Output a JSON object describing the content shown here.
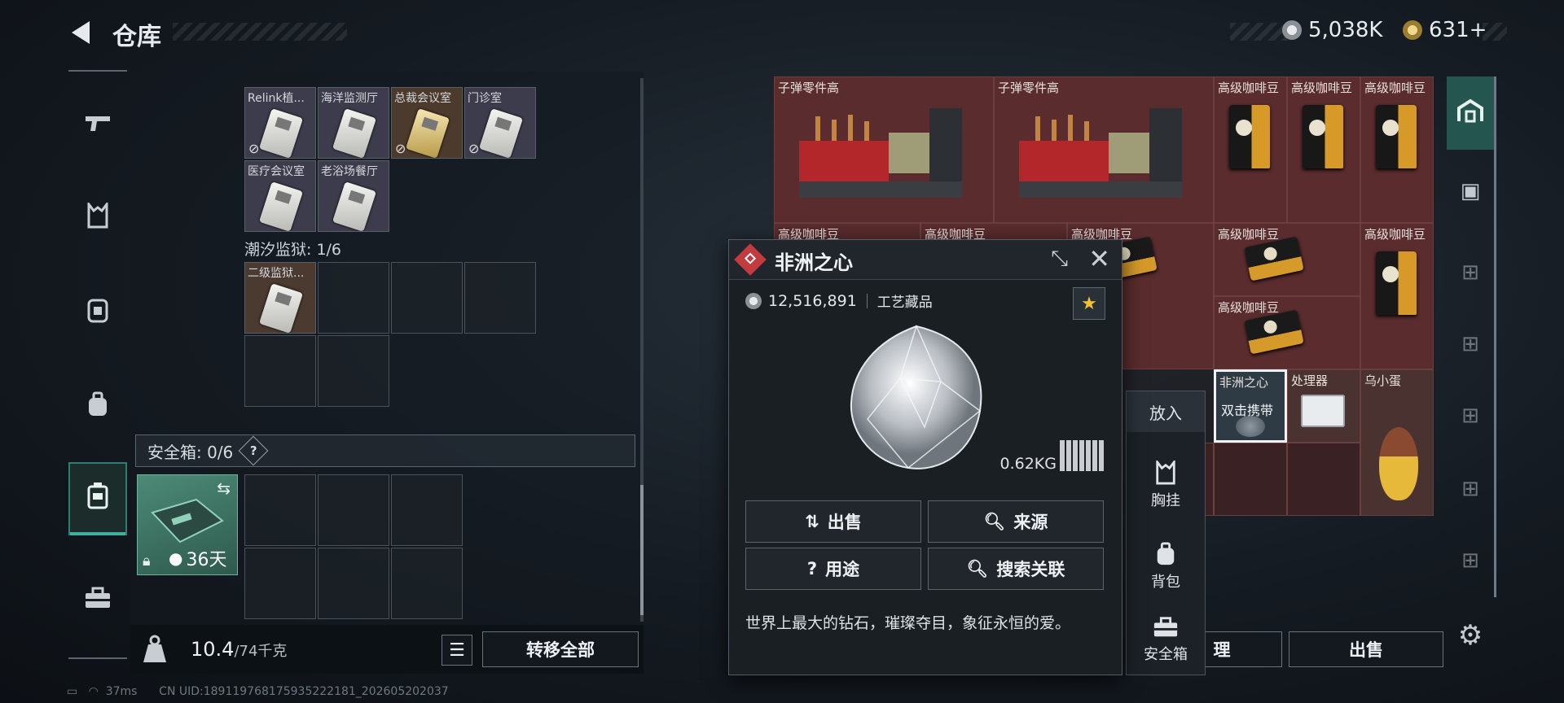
{
  "header": {
    "title": "仓库",
    "currency_1": "5,038K",
    "currency_2": "631+"
  },
  "left_rail": {
    "items": [
      "gun-icon",
      "vest-icon",
      "armor-icon",
      "backpack-icon",
      "safebox-icon",
      "toolbox-icon"
    ],
    "active_index": 4
  },
  "key_items": [
    {
      "label": "Relink植...",
      "banned": true
    },
    {
      "label": "海洋监测厅",
      "banned": false
    },
    {
      "label": "总裁会议室",
      "banned": true
    },
    {
      "label": "门诊室",
      "banned": true
    },
    {
      "label": "医疗会议室",
      "banned": false
    },
    {
      "label": "老浴场餐厅",
      "banned": false
    }
  ],
  "prison_section": {
    "title": "潮汐监狱: 1/6",
    "items": [
      {
        "label": "二级监狱..."
      }
    ]
  },
  "safe_box": {
    "title": "安全箱: 0/6",
    "help": "?",
    "item_timer": "36天"
  },
  "footer": {
    "weight_current": "10.4",
    "weight_max": "/74千克",
    "transfer_all": "转移全部"
  },
  "stash": {
    "items": [
      {
        "label": "子弹零件高",
        "type": "ammo"
      },
      {
        "label": "子弹零件高",
        "type": "ammo"
      },
      {
        "label": "高级咖啡豆",
        "type": "coffee"
      },
      {
        "label": "高级咖啡豆",
        "type": "coffee"
      },
      {
        "label": "高级咖啡豆",
        "type": "coffee"
      },
      {
        "label": "高级咖啡豆",
        "type": "coffee"
      },
      {
        "label": "高级咖啡豆",
        "type": "coffee"
      },
      {
        "label": "高级咖啡豆",
        "type": "coffee-flat"
      },
      {
        "label": "高级咖啡豆",
        "type": "coffee-flat"
      },
      {
        "label": "高级咖啡豆",
        "type": "coffee"
      },
      {
        "label": "高级咖啡豆",
        "type": "coffee-flat"
      },
      {
        "label": "非洲之心",
        "type": "selected",
        "overlay": "双击携带"
      },
      {
        "label": "处理器",
        "type": "processor"
      },
      {
        "label": "乌小蛋",
        "type": "egg"
      }
    ],
    "bottom_buttons": [
      "理",
      "出售"
    ]
  },
  "popup": {
    "title": "非洲之心",
    "price": "12,516,891",
    "category": "工艺藏品",
    "weight": "0.62KG",
    "buttons": {
      "sell": "出售",
      "source": "来源",
      "usage": "用途",
      "search": "搜索关联"
    },
    "description": "世界上最大的钻石，璀璨夺目，象征永恒的爱。"
  },
  "context_menu": {
    "put_in": "放入",
    "items": [
      "胸挂",
      "背包",
      "安全箱"
    ]
  },
  "status_bar": {
    "ping": "37ms",
    "uid": "CN UID:18911976817593522218​1_202605202037"
  },
  "colors": {
    "accent": "#3fb19e",
    "item_bg": "#5a2c2e",
    "danger": "#c33a3f",
    "star": "#f2c230"
  }
}
